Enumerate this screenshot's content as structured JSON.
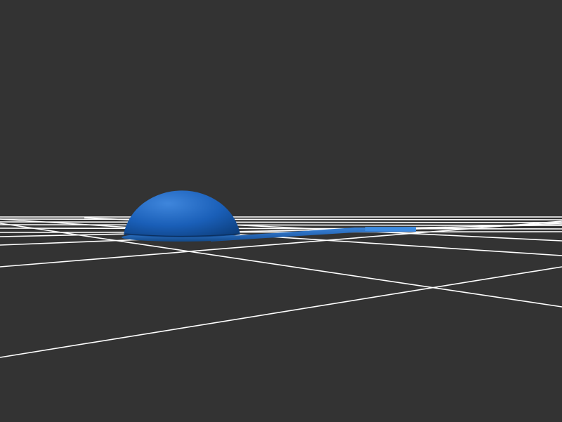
{
  "viewport": {
    "background_color": "#333333",
    "grid_color": "#ffffff"
  },
  "model": {
    "color": "#1a5fb8",
    "highlight_color": "#3f86dc",
    "shadow_color": "#0d3f7e",
    "parts": [
      "dome",
      "base-disc",
      "arm",
      "arm-tip"
    ]
  }
}
